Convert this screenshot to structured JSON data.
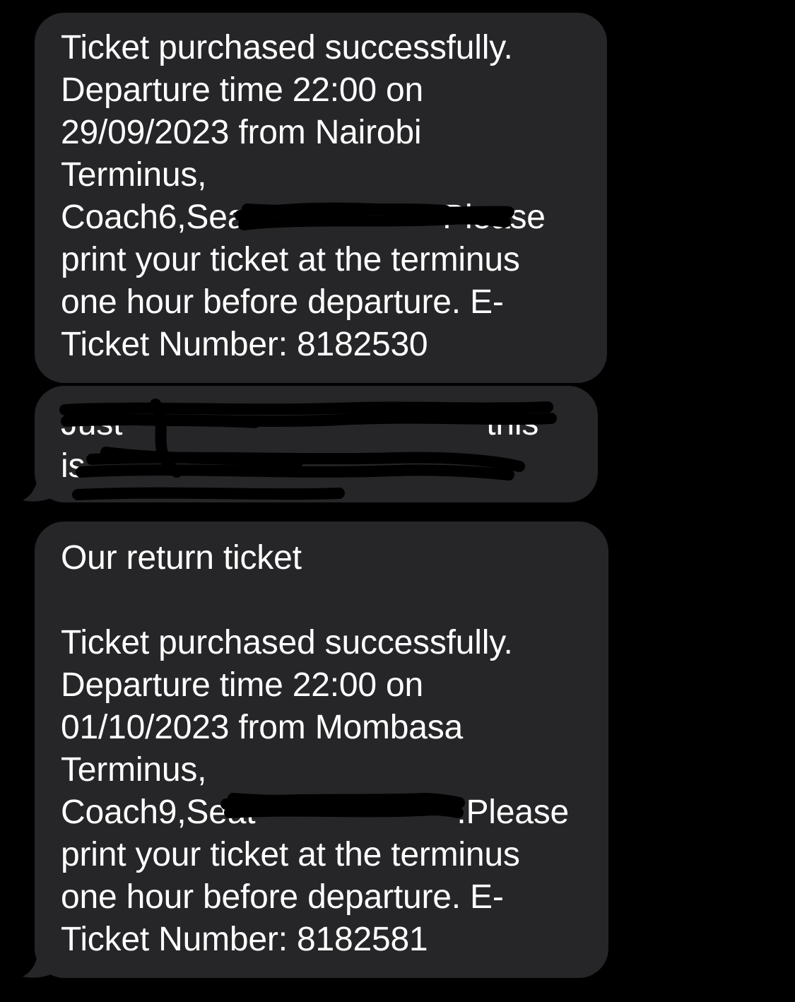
{
  "colors": {
    "background": "#000000",
    "bubble": "#262628",
    "text": "#ffffff",
    "redaction": "#000000"
  },
  "messages": [
    {
      "lines": [
        "Ticket purchased successfully.",
        "Departure time 22:00 on",
        "29/09/2023 from Nairobi",
        "Terminus,",
        "Coach6,Sea",
        "Please",
        "print your ticket at the terminus",
        "one hour before departure. E-",
        "Ticket Number: 8182530"
      ]
    },
    {
      "lines": [
        "Just",
        "this",
        "is"
      ]
    },
    {
      "lines": [
        "Our return ticket",
        "Ticket purchased successfully.",
        "Departure time 22:00 on",
        "01/10/2023 from Mombasa",
        "Terminus,",
        "Coach9,Seat",
        ".Please",
        "print your ticket at the terminus",
        "one hour before departure. E-",
        "Ticket Number: 8182581"
      ]
    }
  ]
}
